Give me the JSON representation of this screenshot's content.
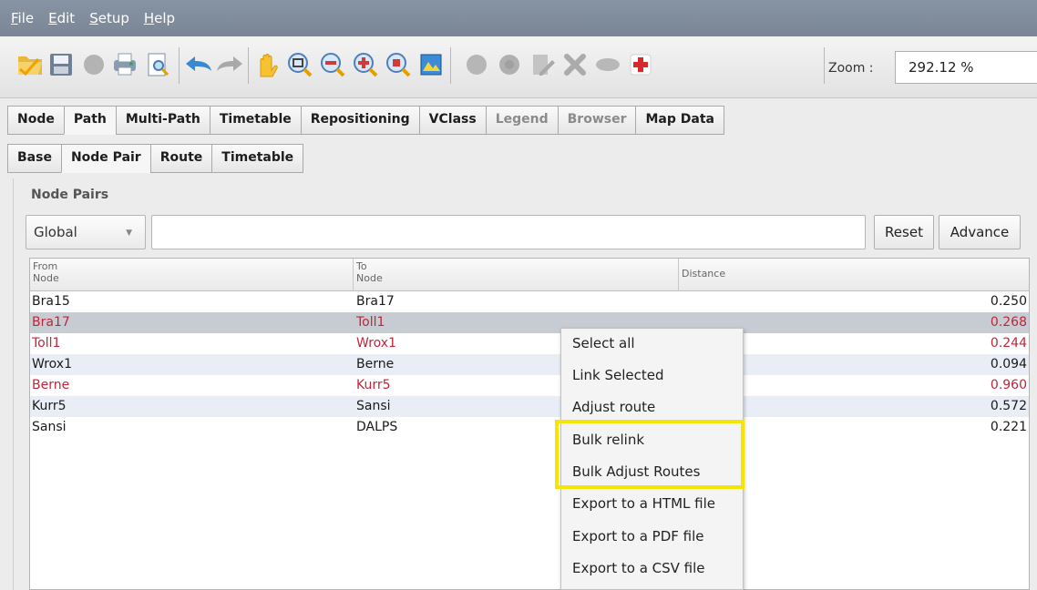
{
  "menubar": {
    "items": [
      {
        "underline": "F",
        "rest": "ile"
      },
      {
        "underline": "E",
        "rest": "dit"
      },
      {
        "underline": "S",
        "rest": "etup"
      },
      {
        "underline": "H",
        "rest": "elp"
      }
    ]
  },
  "toolbar": {
    "zoom_label": "Zoom :",
    "zoom_value": "292.12 %",
    "icons": [
      "open-folder-icon",
      "save-icon",
      "disabled-circle-icon",
      "print-icon",
      "print-preview-icon",
      "undo-icon",
      "redo-icon",
      "pan-hand-icon",
      "zoom-fit-icon",
      "zoom-out-icon",
      "zoom-in-icon",
      "zoom-selection-icon",
      "map-icon",
      "disabled-circle-icon",
      "disabled-circle-icon",
      "disabled-edit-icon",
      "disabled-delete-icon",
      "disabled-ellipse-icon",
      "add-red-cross-icon"
    ]
  },
  "tabs_primary": [
    {
      "label": "Node",
      "state": "normal"
    },
    {
      "label": "Path",
      "state": "active"
    },
    {
      "label": "Multi-Path",
      "state": "normal"
    },
    {
      "label": "Timetable",
      "state": "normal"
    },
    {
      "label": "Repositioning",
      "state": "normal"
    },
    {
      "label": "VClass",
      "state": "normal"
    },
    {
      "label": "Legend",
      "state": "disabled"
    },
    {
      "label": "Browser",
      "state": "disabled"
    },
    {
      "label": "Map Data",
      "state": "normal"
    }
  ],
  "tabs_secondary": [
    {
      "label": "Base",
      "state": "normal"
    },
    {
      "label": "Node Pair",
      "state": "active"
    },
    {
      "label": "Route",
      "state": "normal"
    },
    {
      "label": "Timetable",
      "state": "normal"
    }
  ],
  "node_pairs": {
    "title": "Node Pairs",
    "scope_select": "Global",
    "filter_value": "",
    "reset_label": "Reset",
    "advance_label": "Advance",
    "columns": [
      {
        "line1": "From",
        "line2": "Node"
      },
      {
        "line1": "To",
        "line2": "Node"
      },
      {
        "line1": "Distance",
        "line2": ""
      }
    ],
    "rows": [
      {
        "from": "Bra15",
        "to": "Bra17",
        "distance": "0.250",
        "red": false,
        "selected": false
      },
      {
        "from": "Bra17",
        "to": "Toll1",
        "distance": "0.268",
        "red": true,
        "selected": true
      },
      {
        "from": "Toll1",
        "to": "Wrox1",
        "distance": "0.244",
        "red": true,
        "selected": false
      },
      {
        "from": "Wrox1",
        "to": "Berne",
        "distance": "0.094",
        "red": false,
        "selected": false
      },
      {
        "from": "Berne",
        "to": "Kurr5",
        "distance": "0.960",
        "red": true,
        "selected": false
      },
      {
        "from": "Kurr5",
        "to": "Sansi",
        "distance": "0.572",
        "red": false,
        "selected": false
      },
      {
        "from": "Sansi",
        "to": "DALPS",
        "distance": "0.221",
        "red": false,
        "selected": false
      }
    ]
  },
  "context_menu": {
    "items": [
      "Select all",
      "Link Selected",
      "Adjust route",
      "Bulk relink",
      "Bulk Adjust Routes",
      "Export to a HTML file",
      "Export to a PDF file",
      "Export to a CSV file"
    ],
    "highlight_color": "#f5e500"
  },
  "colors": {
    "menubar": "#7f8b9b",
    "selected_row": "#c7ccd3",
    "alt_row": "#e9eef6",
    "red_text": "#c0253a"
  }
}
